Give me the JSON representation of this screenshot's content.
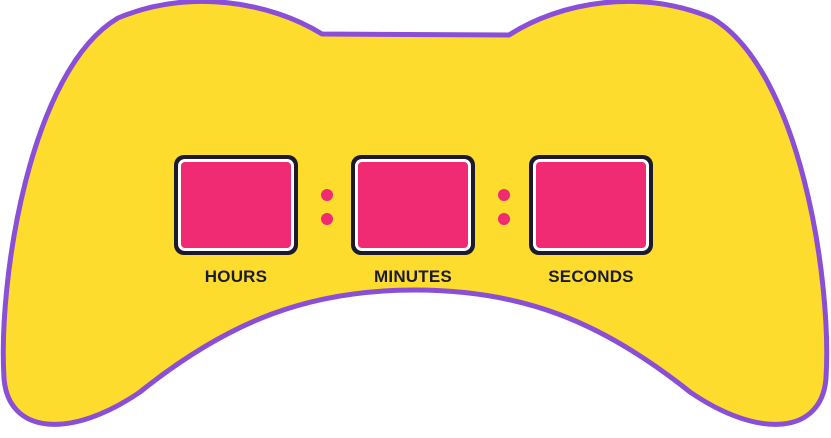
{
  "colors": {
    "body_fill": "#fedc2e",
    "body_outline": "#8a4fd6",
    "slot_fill": "#f02b74",
    "slot_frame": "#1c1b2e",
    "dot": "#f02b74",
    "label": "#1c1b2e"
  },
  "timer": {
    "segments": [
      {
        "id": "hours",
        "label": "HOURS",
        "value": ""
      },
      {
        "id": "minutes",
        "label": "MINUTES",
        "value": ""
      },
      {
        "id": "seconds",
        "label": "SECONDS",
        "value": ""
      }
    ]
  }
}
